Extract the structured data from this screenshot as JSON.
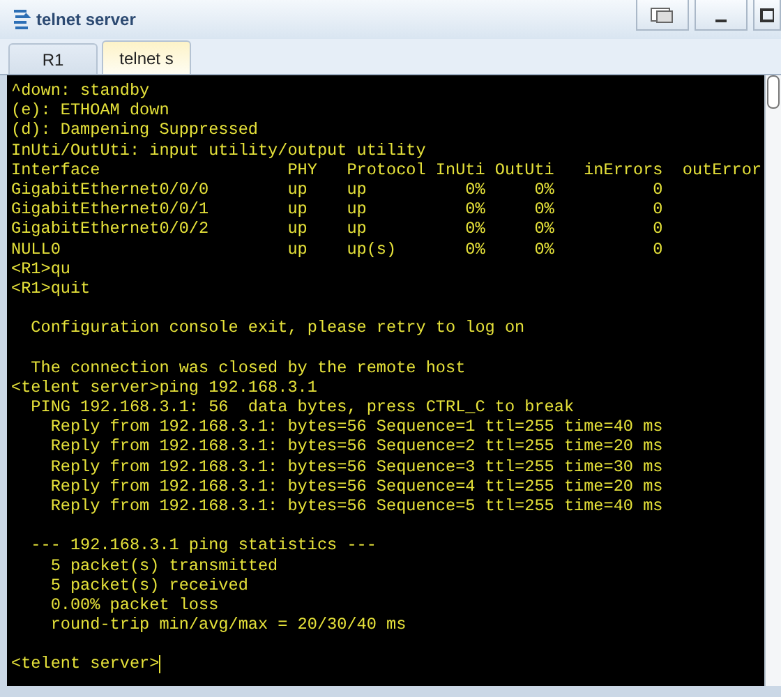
{
  "window": {
    "title": "telnet server"
  },
  "tabs": [
    {
      "label": "R1",
      "selected": false
    },
    {
      "label": "telnet s",
      "selected": true
    }
  ],
  "terminal": {
    "cursor": true,
    "lines": [
      {
        "kind": "text",
        "text": "^down: standby"
      },
      {
        "kind": "text",
        "text": "(e): ETHOAM down"
      },
      {
        "kind": "text",
        "text": "(d): Dampening Suppressed"
      },
      {
        "kind": "text",
        "text": "InUti/OutUti: input utility/output utility"
      },
      {
        "kind": "text",
        "text": "Interface                   PHY   Protocol InUti OutUti   inErrors  outError"
      },
      {
        "kind": "text",
        "text": "GigabitEthernet0/0/0        up    up          0%     0%          0"
      },
      {
        "kind": "text",
        "text": "GigabitEthernet0/0/1        up    up          0%     0%          0"
      },
      {
        "kind": "text",
        "text": "GigabitEthernet0/0/2        up    up          0%     0%          0"
      },
      {
        "kind": "text",
        "text": "NULL0                       up    up(s)       0%     0%          0"
      },
      {
        "kind": "text",
        "text": "<R1>qu"
      },
      {
        "kind": "text",
        "text": "<R1>quit"
      },
      {
        "kind": "blank"
      },
      {
        "kind": "text",
        "text": "  Configuration console exit, please retry to log on"
      },
      {
        "kind": "blank"
      },
      {
        "kind": "text",
        "text": "  The connection was closed by the remote host"
      },
      {
        "kind": "text",
        "text": "<telent server>ping 192.168.3.1"
      },
      {
        "kind": "text",
        "text": "  PING 192.168.3.1: 56  data bytes, press CTRL_C to break"
      },
      {
        "kind": "text",
        "text": "    Reply from 192.168.3.1: bytes=56 Sequence=1 ttl=255 time=40 ms"
      },
      {
        "kind": "text",
        "text": "    Reply from 192.168.3.1: bytes=56 Sequence=2 ttl=255 time=20 ms"
      },
      {
        "kind": "text",
        "text": "    Reply from 192.168.3.1: bytes=56 Sequence=3 ttl=255 time=30 ms"
      },
      {
        "kind": "text",
        "text": "    Reply from 192.168.3.1: bytes=56 Sequence=4 ttl=255 time=20 ms"
      },
      {
        "kind": "text",
        "text": "    Reply from 192.168.3.1: bytes=56 Sequence=5 ttl=255 time=40 ms"
      },
      {
        "kind": "blank"
      },
      {
        "kind": "text",
        "text": "  --- 192.168.3.1 ping statistics ---"
      },
      {
        "kind": "text",
        "text": "    5 packet(s) transmitted"
      },
      {
        "kind": "text",
        "text": "    5 packet(s) received"
      },
      {
        "kind": "text",
        "text": "    0.00% packet loss"
      },
      {
        "kind": "text",
        "text": "    round-trip min/avg/max = 20/30/40 ms"
      },
      {
        "kind": "blank"
      },
      {
        "kind": "prompt",
        "text": "<telent server>"
      }
    ]
  }
}
